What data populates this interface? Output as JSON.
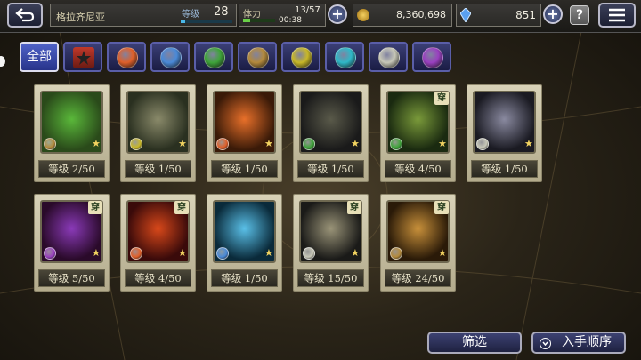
{
  "header": {
    "player_name": "格拉齐尼亚",
    "level_label": "等级",
    "level_value": "28",
    "stamina_label": "体力",
    "stamina_value": "13/57",
    "stamina_timer": "00:38",
    "gil": "8,360,698",
    "crystals": "851",
    "help": "?"
  },
  "filters": [
    {
      "label": "全部",
      "selected": true,
      "icon": "all",
      "color": ""
    },
    {
      "label": "",
      "icon": "summon-emblem-icon",
      "color": "#c0392b"
    },
    {
      "label": "",
      "icon": "fire-icon",
      "color": "#e0602a"
    },
    {
      "label": "",
      "icon": "ice-icon",
      "color": "#4a8ad8"
    },
    {
      "label": "",
      "icon": "wind-icon",
      "color": "#3fa43a"
    },
    {
      "label": "",
      "icon": "earth-icon",
      "color": "#b48a3c"
    },
    {
      "label": "",
      "icon": "thunder-icon",
      "color": "#c8b828"
    },
    {
      "label": "",
      "icon": "water-icon",
      "color": "#2fb8c8"
    },
    {
      "label": "",
      "icon": "light-icon",
      "color": "#c8c8b8"
    },
    {
      "label": "",
      "icon": "dark-icon",
      "color": "#9a40c0"
    }
  ],
  "summons": [
    {
      "name": "cactuar",
      "level": "等级 2/50",
      "element": "earth",
      "equipped": false
    },
    {
      "name": "golem",
      "level": "等级 1/50",
      "element": "thunder",
      "equipped": false
    },
    {
      "name": "bomb",
      "level": "等级 1/50",
      "element": "fire",
      "equipped": false
    },
    {
      "name": "zu",
      "level": "等级 1/50",
      "element": "wind",
      "equipped": false
    },
    {
      "name": "malboro",
      "level": "等级 4/50",
      "element": "wind",
      "equipped": true,
      "wear": "穿"
    },
    {
      "name": "tortoise",
      "level": "等级 1/50",
      "element": "light",
      "equipped": false
    },
    {
      "name": "behemoth",
      "level": "等级 5/50",
      "element": "dark",
      "equipped": true,
      "wear": "穿"
    },
    {
      "name": "ifrit",
      "level": "等级 4/50",
      "element": "fire",
      "equipped": true,
      "wear": "穿"
    },
    {
      "name": "ahriman",
      "level": "等级 1/50",
      "element": "ice",
      "equipped": false
    },
    {
      "name": "iron-giant",
      "level": "等级 15/50",
      "element": "light",
      "equipped": true,
      "wear": "穿"
    },
    {
      "name": "clockwork-golem",
      "level": "等级 24/50",
      "element": "earth",
      "equipped": true,
      "wear": "穿"
    }
  ],
  "footer": {
    "filter_label": "筛选",
    "sort_label": "入手顺序"
  },
  "colors": {
    "accent": "#4f62c8",
    "card": "#d8d2b8",
    "gold": "#f2d360"
  }
}
